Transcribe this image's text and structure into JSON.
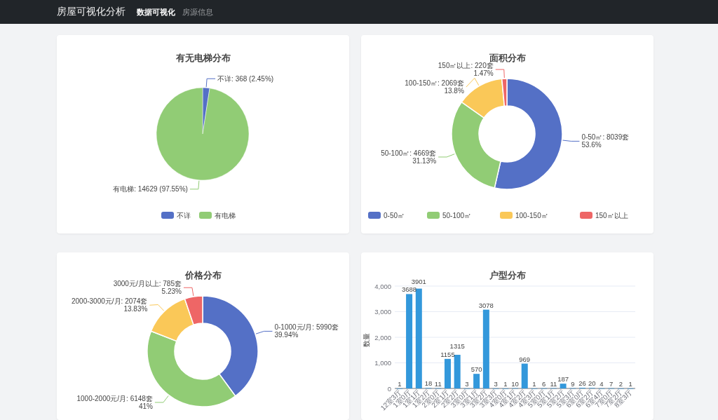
{
  "navbar": {
    "brand": "房屋可视化分析",
    "links": [
      {
        "label": "数据可视化",
        "selected": true
      },
      {
        "label": "房源信息",
        "selected": false
      }
    ]
  },
  "charts": [
    {
      "title": "有无电梯分布",
      "chart_data": {
        "type": "pie",
        "legend": "bottom",
        "categories": [
          "不详",
          "有电梯"
        ],
        "values": [
          368,
          14629
        ],
        "value_labels": [
          "不详: 368 (2.45%)",
          "有电梯: 14629 (97.55%)"
        ]
      }
    },
    {
      "title": "面积分布",
      "chart_data": {
        "type": "donut",
        "legend": "bottom",
        "categories": [
          "0-50㎡",
          "50-100㎡",
          "100-150㎡",
          "150㎡以上"
        ],
        "values": [
          8039,
          4669,
          2069,
          220
        ],
        "value_labels": [
          "0-50㎡: 8039套\n53.6%",
          "50-100㎡: 4669套\n31.13%",
          "100-150㎡: 2069套\n13.8%",
          "150㎡以上: 220套\n1.47%"
        ]
      }
    },
    {
      "title": "价格分布",
      "chart_data": {
        "type": "donut",
        "values": [
          5990,
          6148,
          2074,
          785
        ],
        "value_labels": [
          "0-1000元/月: 5990套\n39.94%",
          "1000-2000元/月: 6148套\n41%",
          "2000-3000元/月: 2074套\n13.83%",
          "3000元/月以上: 785套\n5.23%"
        ]
      }
    },
    {
      "title": "户型分布",
      "chart_data": {
        "type": "bar",
        "grid": true,
        "ylabel": "数量",
        "ylim": [
          0,
          4000
        ],
        "yticks": [
          0,
          {
            "value": 1000,
            "label": "1,000"
          },
          {
            "value": 2000,
            "label": "2,000"
          },
          {
            "value": 3000,
            "label": "3,000"
          },
          {
            "value": 4000,
            "label": "4,000"
          }
        ],
        "data_labels": true,
        "categories": [
          "12室3厅",
          "1室0厅",
          "1室1厅",
          "1室2厅",
          "2室0厅",
          "2室1厅",
          "2室2厅",
          "3室0厅",
          "3室1厅",
          "3室2厅",
          "3室3厅",
          "4室0厅",
          "4室1厅",
          "4室2厅",
          "4室3厅",
          "5室0厅",
          "5室1厅",
          "5室2厅",
          "5室3厅",
          "6室0厅",
          "6室2厅",
          "6室4厅",
          "7室0厅",
          "7室2厅",
          "8室3厅"
        ],
        "values": [
          1,
          3688,
          3901,
          18,
          11,
          1155,
          1315,
          3,
          570,
          3078,
          3,
          1,
          10,
          969,
          1,
          6,
          11,
          187,
          9,
          26,
          20,
          4,
          7,
          2,
          1
        ]
      }
    }
  ]
}
